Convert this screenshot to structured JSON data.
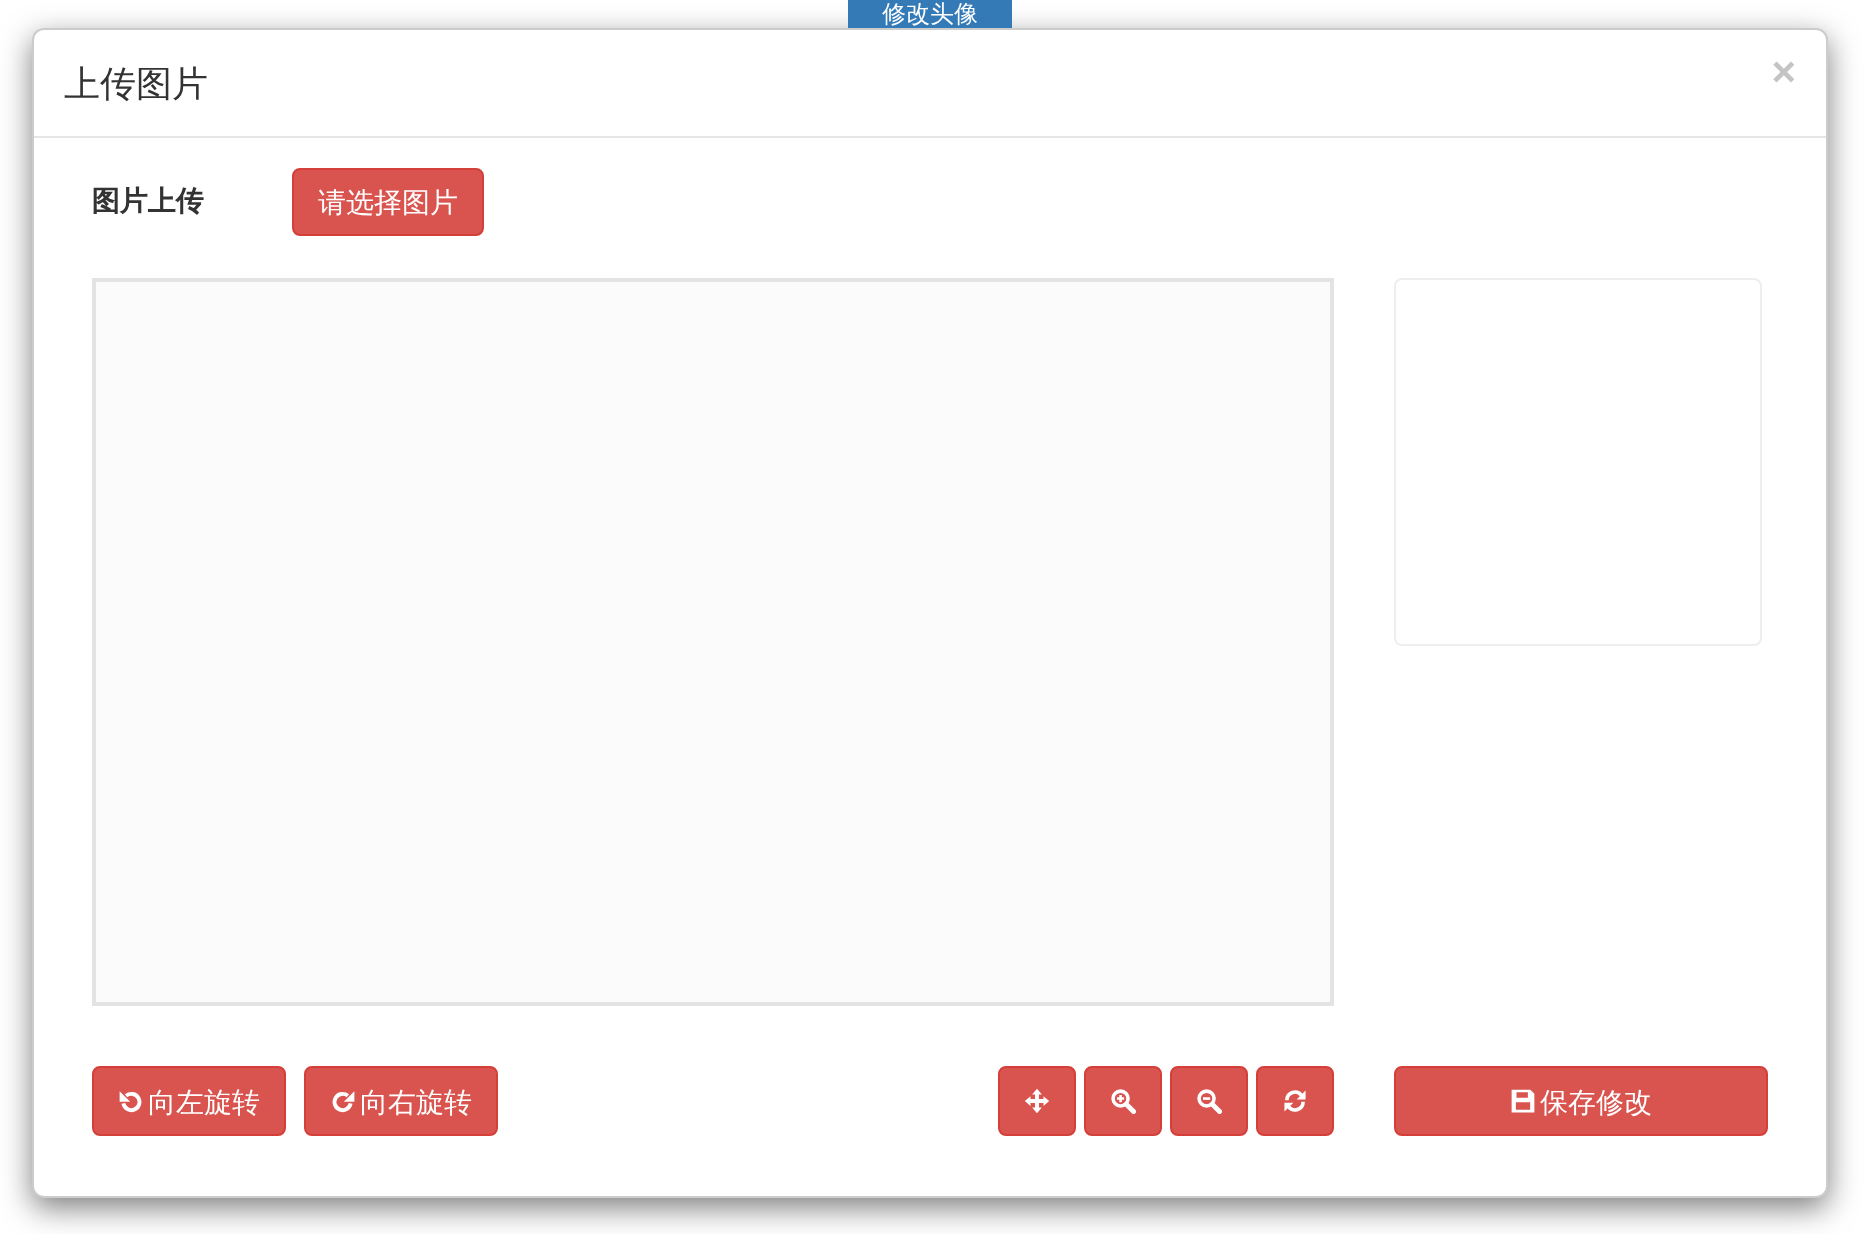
{
  "page_button": {
    "label": "修改头像"
  },
  "dialog": {
    "title": "上传图片",
    "close": "×"
  },
  "upload": {
    "label": "图片上传",
    "button": "请选择图片"
  },
  "toolbar": {
    "rotate": [
      {
        "kind": "rotate-left",
        "label": "向左旋转"
      },
      {
        "kind": "rotate-right",
        "label": "向右旋转"
      }
    ],
    "tools": [
      {
        "kind": "move"
      },
      {
        "kind": "zoom-in"
      },
      {
        "kind": "zoom-out"
      },
      {
        "kind": "reset"
      }
    ]
  },
  "save_button": {
    "label": "保存修改"
  }
}
